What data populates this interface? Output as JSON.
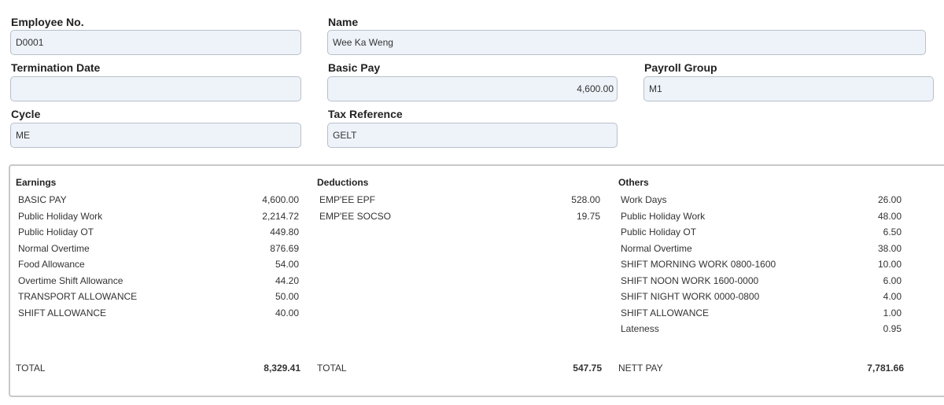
{
  "form": {
    "employee_no": {
      "label": "Employee No.",
      "value": "D0001"
    },
    "name": {
      "label": "Name",
      "value": "Wee Ka Weng"
    },
    "termination_date": {
      "label": "Termination Date",
      "value": ""
    },
    "basic_pay": {
      "label": "Basic Pay",
      "value": "4,600.00"
    },
    "payroll_group": {
      "label": "Payroll Group",
      "value": "M1"
    },
    "cycle": {
      "label": "Cycle",
      "value": "ME"
    },
    "tax_reference": {
      "label": "Tax Reference",
      "value": "GELT"
    }
  },
  "summary": {
    "earnings": {
      "title": "Earnings",
      "items": [
        {
          "name": "BASIC PAY",
          "amount": "4,600.00"
        },
        {
          "name": "Public Holiday Work",
          "amount": "2,214.72"
        },
        {
          "name": "Public Holiday OT",
          "amount": "449.80"
        },
        {
          "name": "Normal Overtime",
          "amount": "876.69"
        },
        {
          "name": "Food Allowance",
          "amount": "54.00"
        },
        {
          "name": "Overtime Shift Allowance",
          "amount": "44.20"
        },
        {
          "name": "TRANSPORT ALLOWANCE",
          "amount": "50.00"
        },
        {
          "name": "SHIFT ALLOWANCE",
          "amount": "40.00"
        }
      ],
      "total_label": "TOTAL",
      "total": "8,329.41"
    },
    "deductions": {
      "title": "Deductions",
      "items": [
        {
          "name": "EMP'EE EPF",
          "amount": "528.00"
        },
        {
          "name": "EMP'EE SOCSO",
          "amount": "19.75"
        }
      ],
      "total_label": "TOTAL",
      "total": "547.75"
    },
    "others": {
      "title": "Others",
      "items": [
        {
          "name": "Work Days",
          "amount": "26.00"
        },
        {
          "name": "Public Holiday Work",
          "amount": "48.00"
        },
        {
          "name": "Public Holiday OT",
          "amount": "6.50"
        },
        {
          "name": "Normal Overtime",
          "amount": "38.00"
        },
        {
          "name": "SHIFT MORNING WORK 0800-1600",
          "amount": "10.00"
        },
        {
          "name": "SHIFT NOON WORK 1600-0000",
          "amount": "6.00"
        },
        {
          "name": "SHIFT NIGHT WORK 0000-0800",
          "amount": "4.00"
        },
        {
          "name": "SHIFT ALLOWANCE",
          "amount": "1.00"
        },
        {
          "name": "Lateness",
          "amount": "0.95"
        }
      ],
      "total_label": "NETT PAY",
      "total": "7,781.66"
    }
  }
}
